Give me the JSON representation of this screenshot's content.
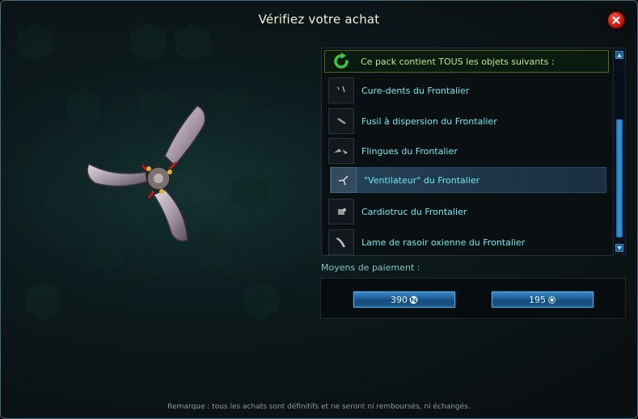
{
  "dialog": {
    "title": "Vérifiez votre achat",
    "close_icon": "close-icon"
  },
  "pack": {
    "header": "Ce pack contient TOUS les objets suivants :",
    "items": [
      {
        "label": "Cure-dents du Frontalier",
        "icon": "toothpick-icon",
        "selected": false
      },
      {
        "label": "Fusil à dispersion du Frontalier",
        "icon": "shotgun-icon",
        "selected": false
      },
      {
        "label": "Flingues du Frontalier",
        "icon": "pistols-icon",
        "selected": false
      },
      {
        "label": "\"Ventilateur\" du Frontalier",
        "icon": "fan-icon",
        "selected": true
      },
      {
        "label": "Cardiotruc du Frontalier",
        "icon": "gadget-icon",
        "selected": false
      },
      {
        "label": "Lame de rasoir oxienne du Frontalier",
        "icon": "razor-blade-icon",
        "selected": false
      }
    ]
  },
  "payment": {
    "label": "Moyens de paiement :",
    "options": [
      {
        "amount": "390",
        "icon": "ncoin-icon"
      },
      {
        "amount": "195",
        "icon": "gear-coin-icon"
      }
    ]
  },
  "remark": "Remarque : tous les achats sont définitifs et ne seront ni remboursés, ni échangés.",
  "colors": {
    "accent": "#6ee8ee",
    "header_text": "#c6e28c",
    "button_blue": "#1e5e96",
    "close_red": "#c8180f"
  }
}
